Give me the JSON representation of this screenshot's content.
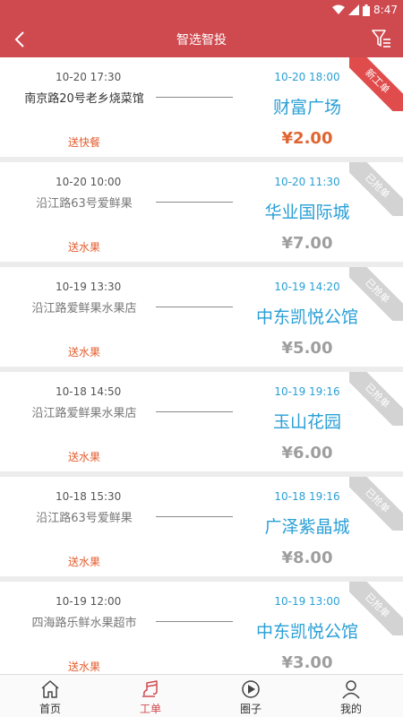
{
  "status": {
    "time": "8:47"
  },
  "header": {
    "title": "智选智投"
  },
  "orders": [
    {
      "from_time": "10-20 17:30",
      "from_addr": "南京路20号老乡烧菜馆",
      "service": "送快餐",
      "to_time": "10-20 18:00",
      "to_addr": "财富广场",
      "price": "¥2.00",
      "badge": "新工单",
      "active": true
    },
    {
      "from_time": "10-20 10:00",
      "from_addr": "沿江路63号爱鲜果",
      "service": "送水果",
      "to_time": "10-20 11:30",
      "to_addr": "华业国际城",
      "price": "¥7.00",
      "badge": "已抢单",
      "active": false
    },
    {
      "from_time": "10-19 13:30",
      "from_addr": "沿江路爱鲜果水果店",
      "service": "送水果",
      "to_time": "10-19 14:20",
      "to_addr": "中东凯悦公馆",
      "price": "¥5.00",
      "badge": "已抢单",
      "active": false
    },
    {
      "from_time": "10-18 14:50",
      "from_addr": "沿江路爱鲜果水果店",
      "service": "送水果",
      "to_time": "10-19 19:16",
      "to_addr": "玉山花园",
      "price": "¥6.00",
      "badge": "已抢单",
      "active": false
    },
    {
      "from_time": "10-18 15:30",
      "from_addr": "沿江路63号爱鲜果",
      "service": "送水果",
      "to_time": "10-18 19:16",
      "to_addr": "广泽紫晶城",
      "price": "¥8.00",
      "badge": "已抢单",
      "active": false
    },
    {
      "from_time": "10-19 12:00",
      "from_addr": "四海路乐鲜水果超市",
      "service": "送水果",
      "to_time": "10-19 13:00",
      "to_addr": "中东凯悦公馆",
      "price": "¥3.00",
      "badge": "已抢单",
      "active": false
    }
  ],
  "tabs": [
    {
      "label": "首页",
      "icon": "home-icon"
    },
    {
      "label": "工单",
      "icon": "work-order-icon"
    },
    {
      "label": "圈子",
      "icon": "circle-play-icon"
    },
    {
      "label": "我的",
      "icon": "person-icon"
    }
  ],
  "colors": {
    "primary": "#cf4a4f",
    "accent_blue": "#2a9fd6",
    "price_active": "#e06430",
    "service_text": "#e35d2f"
  }
}
